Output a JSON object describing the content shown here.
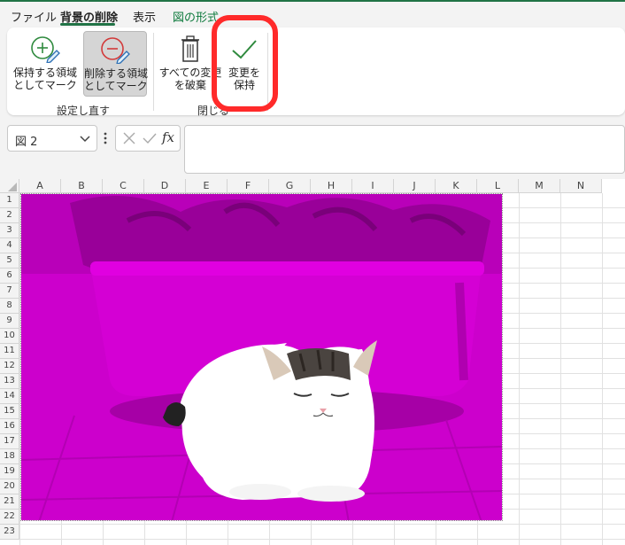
{
  "menubar": {
    "items": [
      {
        "label": "ファイル"
      },
      {
        "label": "背景の削除"
      },
      {
        "label": "表示"
      },
      {
        "label": "図の形式"
      }
    ]
  },
  "ribbon": {
    "mark_keep": {
      "line1": "保持する領域",
      "line2": "としてマーク"
    },
    "mark_remove": {
      "line1": "削除する領域",
      "line2": "としてマーク"
    },
    "discard": {
      "line1": "すべての変更",
      "line2": "を破棄"
    },
    "keep": {
      "line1": "変更を",
      "line2": "保持"
    },
    "groups": {
      "refine": "設定し直す",
      "close": "閉じる"
    }
  },
  "formula_bar": {
    "name_box": "図 2",
    "fx_label": "fx",
    "value": ""
  },
  "sheet": {
    "columns": [
      "A",
      "B",
      "C",
      "D",
      "E",
      "F",
      "G",
      "H",
      "I",
      "J",
      "K",
      "L",
      "M",
      "N"
    ],
    "rows": [
      "1",
      "2",
      "3",
      "4",
      "5",
      "6",
      "7",
      "8",
      "9",
      "10",
      "11",
      "12",
      "13",
      "14",
      "15",
      "16",
      "17",
      "18",
      "19",
      "20",
      "21",
      "22",
      "23"
    ]
  },
  "colors": {
    "accent": "#217346",
    "removal_overlay": "#cc00cc",
    "highlight": "#ff2a2a"
  },
  "icons": {
    "mark_keep": "plus-pencil-icon",
    "mark_remove": "minus-pencil-icon",
    "discard": "trash-icon",
    "keep": "checkmark-icon"
  }
}
